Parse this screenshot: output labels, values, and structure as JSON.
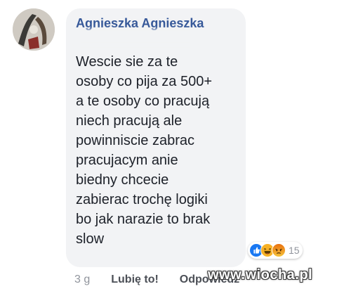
{
  "comment": {
    "author": "Agnieszka Agnieszka",
    "body": "Wescie sie za te\nosoby co pija za 500+\na te osoby co pracują\nniech pracują ale\npowinniscie zabrac\npracujacym anie\nbiedny chcecie\nzabierac trochę logiki\nbo jak narazie to brak\nslow",
    "reactions": {
      "icons": [
        "like-icon",
        "haha-icon",
        "angry-icon"
      ],
      "count": "15",
      "colors": {
        "like": "#1877f2",
        "haha": "#f7b125",
        "angry": "#e9710f"
      }
    },
    "actions": {
      "time": "3 g",
      "like_label": "Lubię to!",
      "reply_label": "Odpowiedz"
    }
  },
  "watermark": "www.wiocha.pl",
  "colors": {
    "author": "#365899",
    "bubble": "#f2f3f5",
    "meta": "#90949c"
  }
}
